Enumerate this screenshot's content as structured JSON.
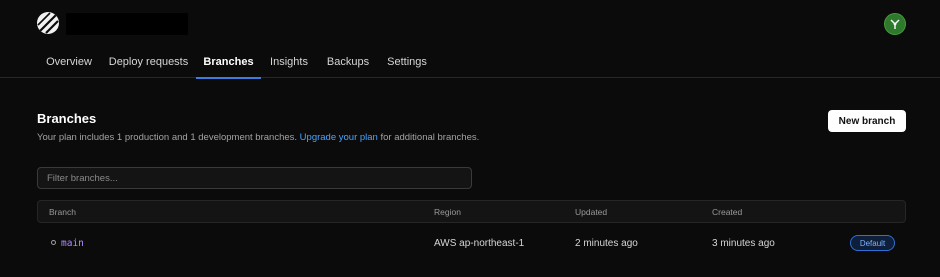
{
  "header": {
    "logo_icon": "planetscale-logo-icon",
    "avatar_icon": "user-avatar-icon",
    "avatar_color": "#2d7a2d"
  },
  "nav": {
    "tabs": [
      {
        "label": "Overview",
        "active": false
      },
      {
        "label": "Deploy requests",
        "active": false
      },
      {
        "label": "Branches",
        "active": true
      },
      {
        "label": "Insights",
        "active": false
      },
      {
        "label": "Backups",
        "active": false
      },
      {
        "label": "Settings",
        "active": false
      }
    ],
    "accent_color": "#3d7be0"
  },
  "branches": {
    "title": "Branches",
    "description_prefix": "Your plan includes 1 production and 1 development branches. ",
    "upgrade_link": "Upgrade your plan",
    "description_suffix": " for additional branches.",
    "new_branch_label": "New branch",
    "filter_placeholder": "Filter branches...",
    "columns": [
      "Branch",
      "Region",
      "Updated",
      "Created"
    ],
    "rows": [
      {
        "branch": "main",
        "region": "AWS ap-northeast-1",
        "updated": "2 minutes ago",
        "created": "3 minutes ago",
        "badge": "Default"
      }
    ]
  },
  "colors": {
    "background": "#0b0b0b",
    "link": "#4aa3ff",
    "branch_name": "#b28cff",
    "badge_border": "#2f6fd6"
  }
}
